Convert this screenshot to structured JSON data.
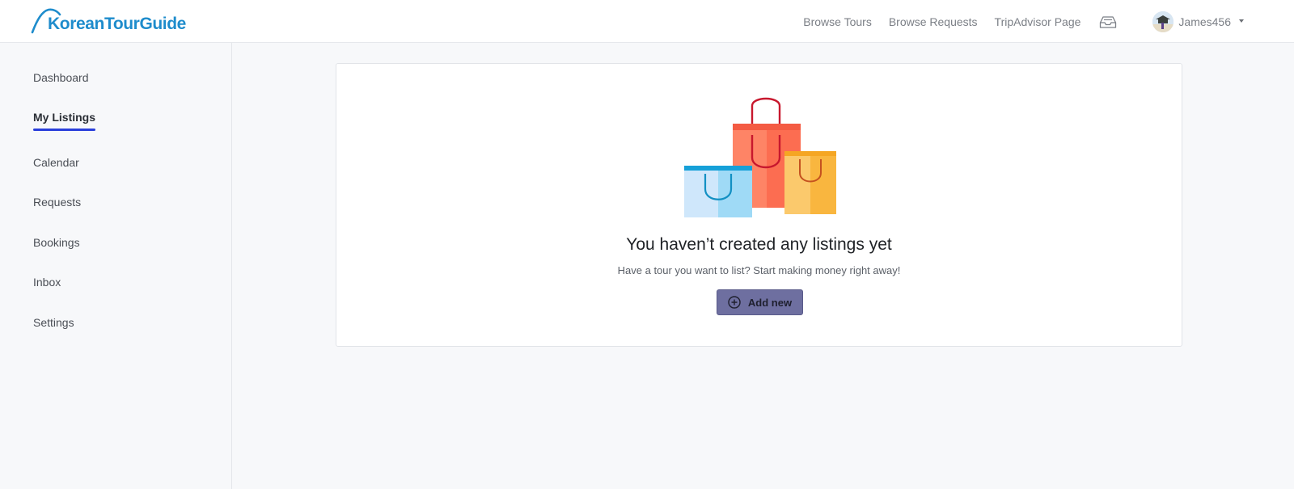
{
  "brand": {
    "name": "KoreanTourGuide",
    "color": "#1e8ccc"
  },
  "topnav": {
    "links": [
      "Browse Tours",
      "Browse Requests",
      "TripAdvisor Page"
    ],
    "inbox_icon": "inbox-tray-icon",
    "user": {
      "name": "James456",
      "avatar": "avatar-photo",
      "menu_icon": "caret-down-icon"
    }
  },
  "sidebar": {
    "items": [
      {
        "label": "Dashboard",
        "active": false
      },
      {
        "label": "My Listings",
        "active": true
      },
      {
        "label": "Calendar",
        "active": false
      },
      {
        "label": "Requests",
        "active": false
      },
      {
        "label": "Bookings",
        "active": false
      },
      {
        "label": "Inbox",
        "active": false
      },
      {
        "label": "Settings",
        "active": false
      }
    ],
    "accent": "#2a3fdb"
  },
  "empty_state": {
    "illustration": "shopping-bags-illustration",
    "title": "You haven’t created any listings yet",
    "subtitle": "Have a tour you want to list? Start making money right away!",
    "button_label": "Add new",
    "button_icon": "plus-circle-icon",
    "button_color": "#6e6fa0"
  }
}
